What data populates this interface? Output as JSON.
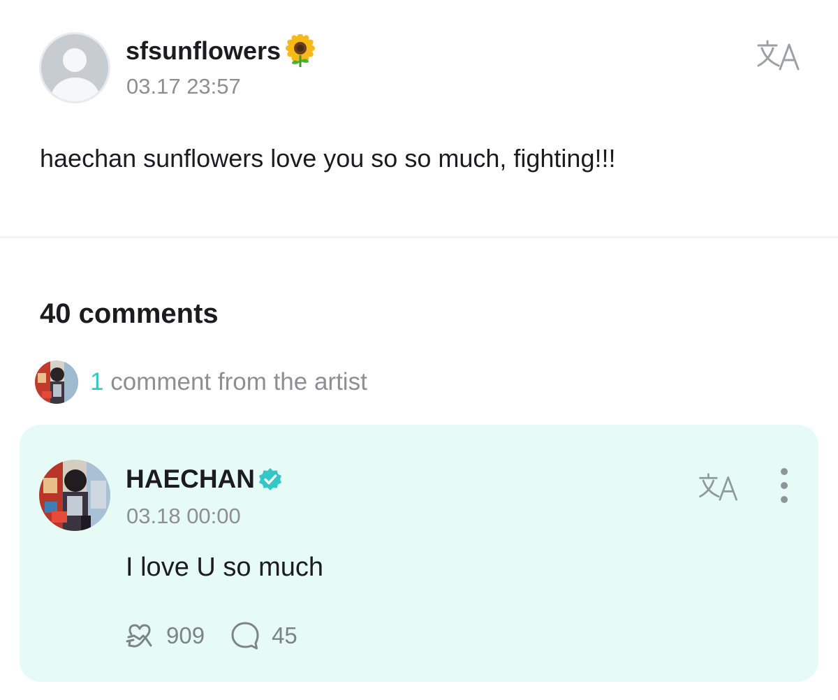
{
  "post": {
    "username": "sfsunflowers",
    "username_emoji": "sunflower",
    "timestamp": "03.17 23:57",
    "body": "haechan sunflowers love you so so much, fighting!!!",
    "translate_icon": "translate-icon"
  },
  "comments": {
    "count_label": "40 comments",
    "artist_count": "1",
    "artist_label": "comment from the artist"
  },
  "artist_comment": {
    "name": "HAECHAN",
    "verified_icon": "verified-badge-icon",
    "timestamp": "03.18 00:00",
    "text": "I love U so much",
    "reactions": "909",
    "replies": "45",
    "more_icon": "more-vertical-icon"
  },
  "colors": {
    "accent": "#35c6c8",
    "card_background": "#e6faf6",
    "verified": "#35c6c8",
    "muted_text": "#8e8e93"
  }
}
